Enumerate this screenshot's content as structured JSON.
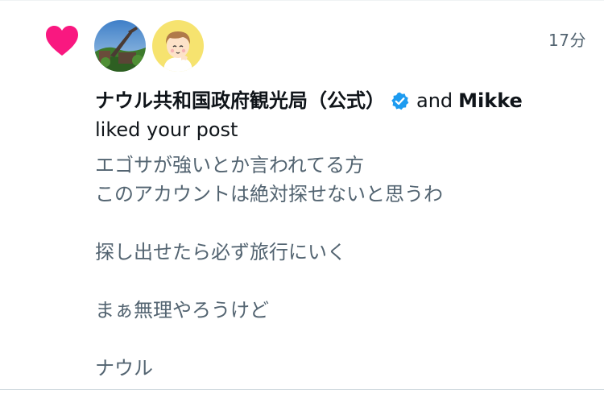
{
  "notification": {
    "type_icon": "heart-icon",
    "accent_color": "#f91880",
    "timestamp": "17分",
    "avatars": [
      {
        "name": "avatar-landscape",
        "description_icon": "tower-landscape-avatar"
      },
      {
        "name": "avatar-cartoon",
        "description_icon": "cartoon-boy-avatar"
      }
    ],
    "actor_primary": "ナウル共和国政府観光局（公式）",
    "verified_icon": "verified-badge-icon",
    "verified_color": "#1d9bf0",
    "conjunction": "and",
    "actor_secondary": "Mikke",
    "action_text": "liked your post",
    "post_lines": [
      "エゴサが強いとか言われてる方",
      "このアカウントは絶対探せないと思うわ",
      "",
      "探し出せたら必ず旅行にいく",
      "",
      "まぁ無理やろうけど",
      "",
      "ナウル"
    ]
  }
}
